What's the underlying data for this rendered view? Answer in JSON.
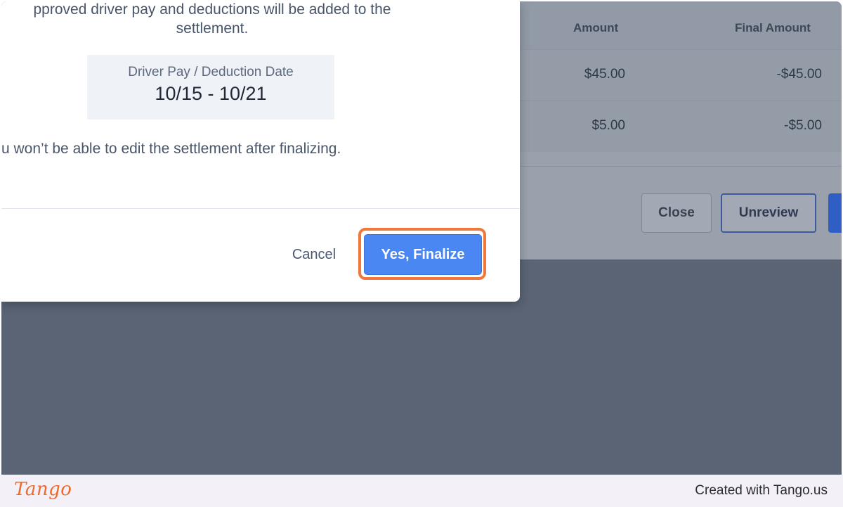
{
  "background": {
    "table": {
      "headers": [
        "Amount",
        "Final Amount"
      ],
      "rows": [
        {
          "amount": "$45.00",
          "final_amount": "-$45.00"
        },
        {
          "amount": "$5.00",
          "final_amount": "-$5.00"
        }
      ]
    },
    "buttons": {
      "close": "Close",
      "unreview": "Unreview"
    }
  },
  "modal": {
    "message_line1": "pproved driver pay and deductions will be added to the",
    "message_line2": "settlement.",
    "date_label": "Driver Pay / Deduction Date",
    "date_range": "10/15 - 10/21",
    "warning": "u won’t be able to edit the settlement after finalizing.",
    "cancel_label": "Cancel",
    "confirm_label": "Yes, Finalize"
  },
  "footer": {
    "logo_text": "Tango",
    "credit": "Created with Tango.us"
  },
  "colors": {
    "primary": "#4a87f3",
    "highlight": "#f0783b",
    "overlay": "#5a6475"
  }
}
